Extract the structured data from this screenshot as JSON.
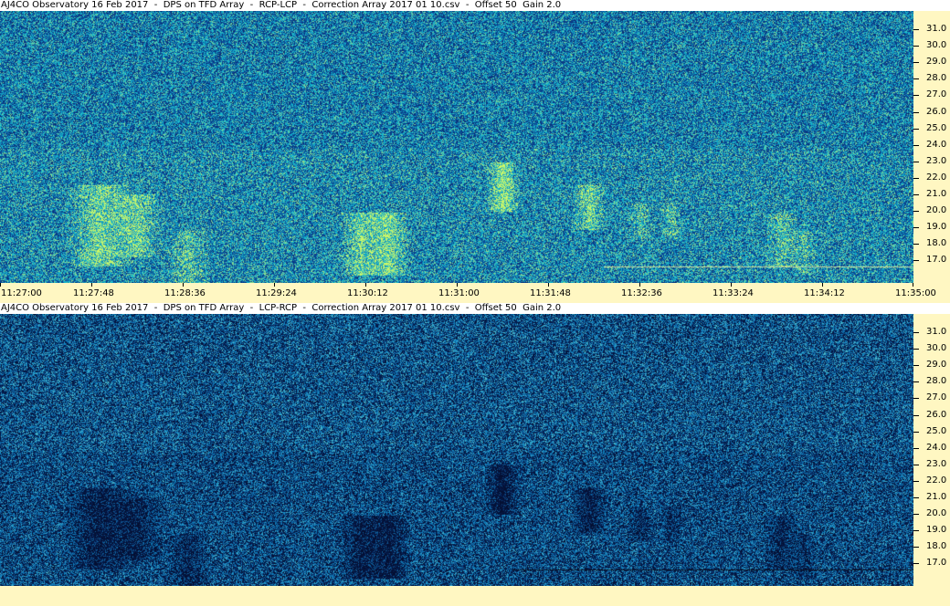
{
  "panels": [
    {
      "title": "AJ4CO Observatory 16 Feb 2017  -  DPS on TFD Array  -  RCP-LCP  -  Correction Array 2017 01 10.csv  -  Offset 50  Gain 2.0",
      "scheme": "bright",
      "y_labels": [
        "31.0",
        "30.0",
        "29.0",
        "28.0",
        "27.0",
        "26.0",
        "25.0",
        "24.0",
        "23.0",
        "22.0",
        "21.0",
        "20.0",
        "19.0",
        "18.0",
        "17.0"
      ]
    },
    {
      "title": "AJ4CO Observatory 16 Feb 2017  -  DPS on TFD Array  -  LCP-RCP  -  Correction Array 2017 01 10.csv  -  Offset 50  Gain 2.0",
      "scheme": "dark",
      "y_labels": [
        "31.0",
        "30.0",
        "29.0",
        "28.0",
        "27.0",
        "26.0",
        "25.0",
        "24.0",
        "23.0",
        "22.0",
        "21.0",
        "20.0",
        "19.0",
        "18.0",
        "17.0"
      ]
    }
  ],
  "x_axis": {
    "labels": [
      "11:27:00",
      "11:27:48",
      "11:28:36",
      "11:29:24",
      "11:30:12",
      "11:31:00",
      "11:31:48",
      "11:32:36",
      "11:33:24",
      "11:34:12",
      "11:35:00"
    ]
  },
  "colors": {
    "axis_bg": "#fff7c2",
    "spectrum_blue": "#1e5aa8",
    "spectrum_cyan": "#29b6e0",
    "spectrum_green": "#8fe05a",
    "spectrum_dark": "#061a4a"
  }
}
